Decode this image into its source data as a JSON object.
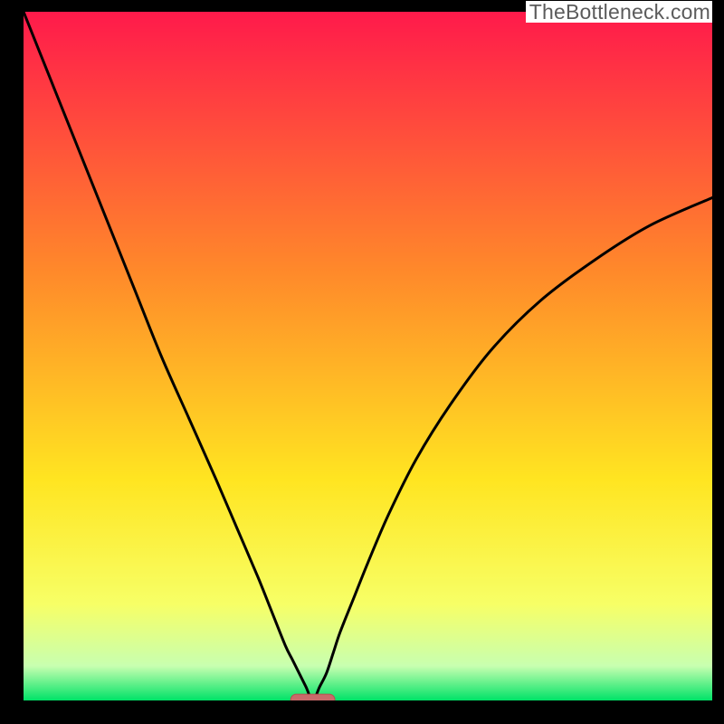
{
  "attribution": "TheBottleneck.com",
  "colors": {
    "curve": "#000000",
    "marker_fill": "#c96a6a",
    "marker_stroke": "#b84f4f",
    "grad_top": "#ff1a4b",
    "grad_mid1": "#ff8a2a",
    "grad_mid2": "#ffe521",
    "grad_low1": "#f7ff66",
    "grad_low2": "#c8ffb0",
    "grad_bottom": "#00e267"
  },
  "chart_data": {
    "type": "line",
    "title": "",
    "xlabel": "",
    "ylabel": "",
    "xlim": [
      0,
      100
    ],
    "ylim": [
      0,
      100
    ],
    "min_x": 42,
    "series": [
      {
        "name": "curve",
        "x": [
          0,
          4,
          8,
          12,
          16,
          20,
          24,
          28,
          31,
          34,
          36,
          38,
          39,
          40,
          41,
          42,
          43,
          44,
          45,
          46,
          48,
          50,
          53,
          57,
          62,
          68,
          75,
          83,
          91,
          100
        ],
        "y": [
          100,
          90,
          80,
          70,
          60,
          50,
          41,
          32,
          25,
          18,
          13,
          8,
          6,
          4,
          2,
          0,
          2,
          4,
          7,
          10,
          15,
          20,
          27,
          35,
          43,
          51,
          58,
          64,
          69,
          73
        ]
      }
    ],
    "marker": {
      "x": 42,
      "y": 0,
      "rx_pct": 3.2,
      "ry_pct": 0.9
    }
  }
}
